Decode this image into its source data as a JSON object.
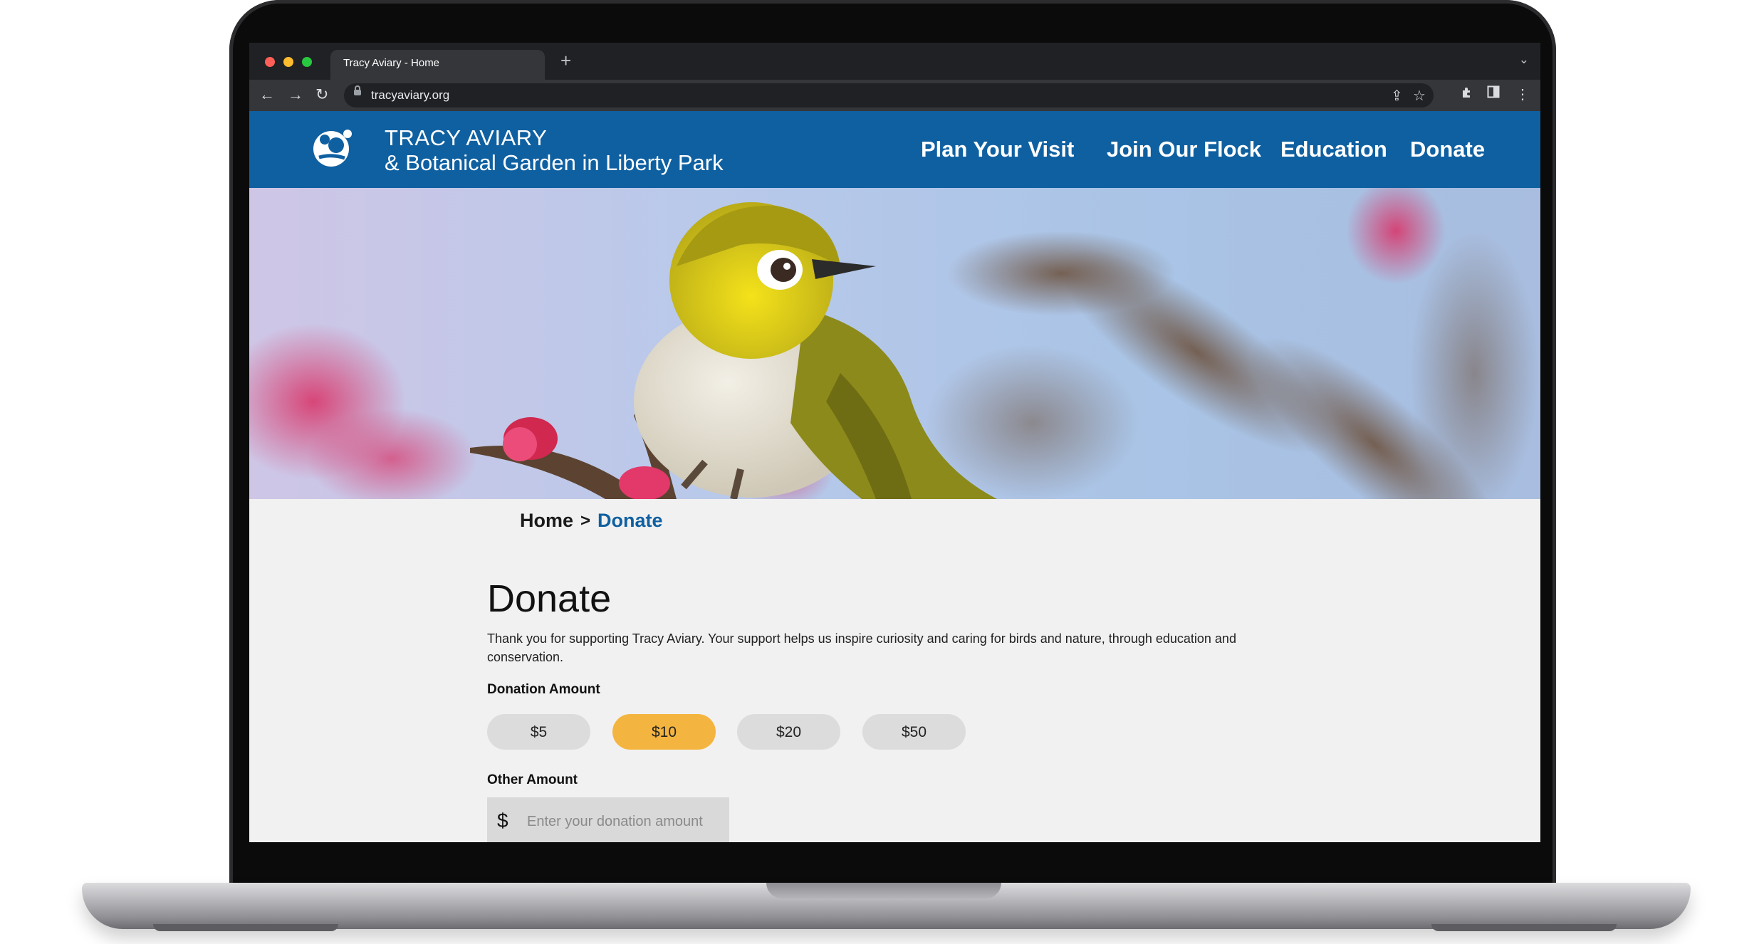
{
  "browser": {
    "tab_title": "Tracy Aviary - Home",
    "new_tab": "+",
    "url": "tracyaviary.org"
  },
  "site": {
    "brand_line1": "TRACY AVIARY",
    "brand_line2": "& Botanical Garden in Liberty Park",
    "nav": [
      "Plan Your Visit",
      "Join Our Flock",
      "Education",
      "Donate"
    ],
    "brand_color": "#0f60a1",
    "accent_color": "#f4b540"
  },
  "breadcrumb": {
    "home": "Home",
    "separator": ">",
    "current": "Donate"
  },
  "donate": {
    "title": "Donate",
    "intro": "Thank you for supporting Tracy Aviary. Your support helps us inspire curiosity and caring for birds and nature, through education and conservation.",
    "amount_label": "Donation Amount",
    "amounts": [
      "$5",
      "$10",
      "$20",
      "$50"
    ],
    "selected_amount": "$10",
    "other_label": "Other Amount",
    "currency_symbol": "$",
    "other_placeholder": "Enter your donation amount"
  },
  "icons": [
    "back-arrow-icon",
    "forward-arrow-icon",
    "reload-icon",
    "lock-icon",
    "share-icon",
    "star-icon",
    "extensions-icon",
    "side-panel-icon",
    "kebab-menu-icon",
    "tab-list-chevron-icon",
    "aviary-logo-icon"
  ]
}
